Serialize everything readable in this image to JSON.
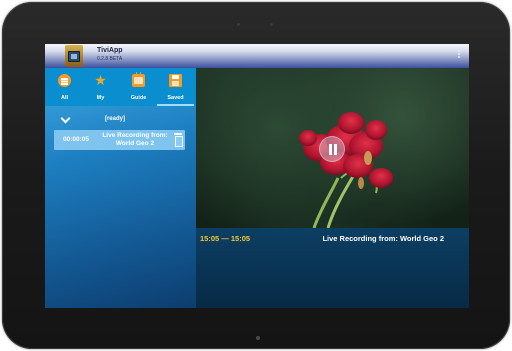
{
  "app": {
    "title": "TiviApp",
    "version": "0.2.8 BETA"
  },
  "tabs": [
    {
      "label": "All",
      "icon": "list-icon"
    },
    {
      "label": "My",
      "icon": "star-icon"
    },
    {
      "label": "Guide",
      "icon": "tv-guide-icon"
    },
    {
      "label": "Saved",
      "icon": "save-icon",
      "active": true
    }
  ],
  "saved": {
    "status": "[ready]",
    "recording": {
      "time": "00:00:05",
      "title": "Live Recording from: World Geo 2"
    }
  },
  "player": {
    "time_range": "15:05 — 15:05",
    "title": "Live Recording from: World Geo 2",
    "state": "paused"
  },
  "colors": {
    "accent": "#0a8ed0",
    "time_highlight": "#f2cc2c",
    "icon_orange": "#f39c2a"
  }
}
